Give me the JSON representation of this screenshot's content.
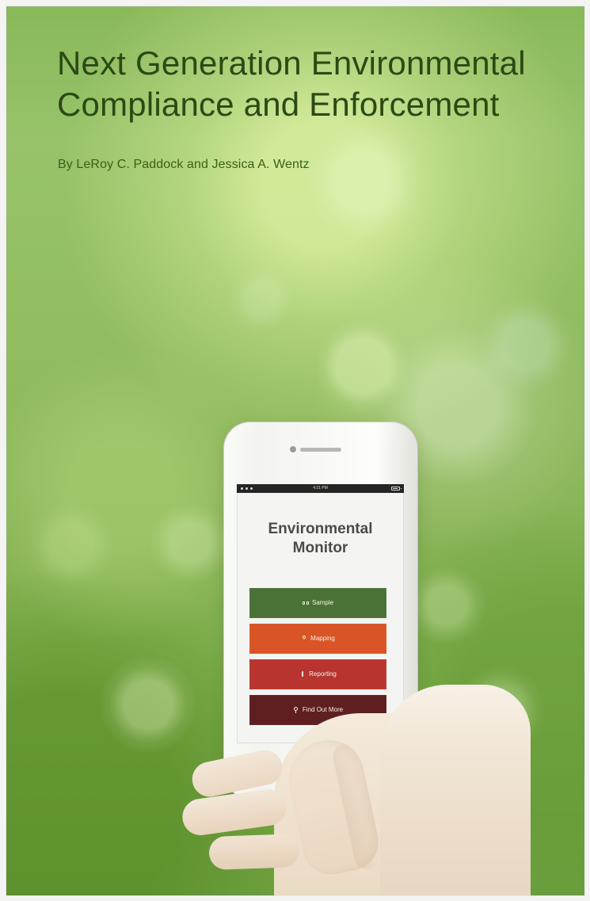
{
  "cover": {
    "title": "Next Generation Environmental\nCompliance and Enforcement",
    "authors": "By LeRoy C. Paddock and Jessica A. Wentz"
  },
  "phone": {
    "status_bar": {
      "time": "4:21 PM"
    },
    "app_title": "Environmental\nMonitor",
    "menu": [
      {
        "label": "Sample",
        "icon": "binoculars-icon"
      },
      {
        "label": "Mapping",
        "icon": "pin-icon"
      },
      {
        "label": "Reporting",
        "icon": "report-icon"
      },
      {
        "label": "Find Out More",
        "icon": "info-icon"
      }
    ]
  },
  "colors": {
    "background_green": "#89b85a",
    "title_green": "#2b4a13",
    "author_green": "#3b5f16",
    "sample_button": "#4a7236",
    "mapping_button": "#d95526",
    "reporting_button": "#b8352f",
    "find_out_more_button": "#5f1f21"
  }
}
